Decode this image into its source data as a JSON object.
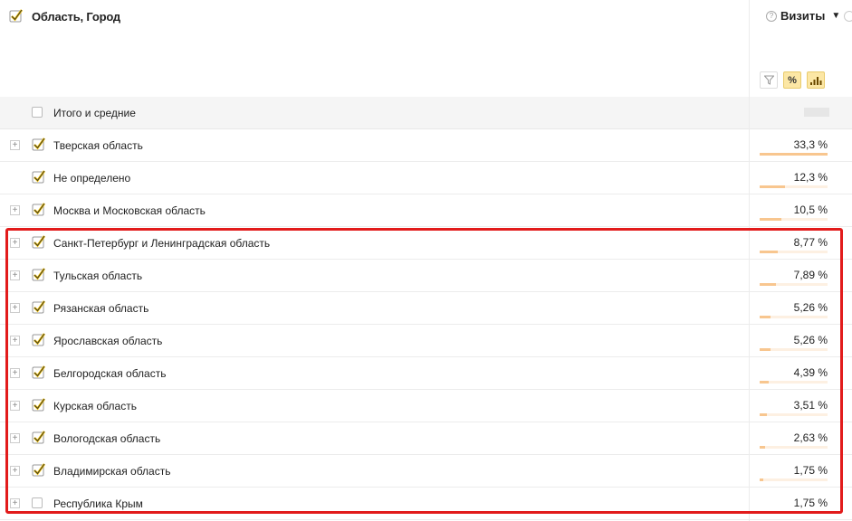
{
  "header": {
    "title": "Область, Город",
    "metric": "Визиты",
    "percent_symbol": "%"
  },
  "total_row": {
    "label": "Итого и средние"
  },
  "rows": [
    {
      "label": "Тверская область",
      "value": "33,3 %",
      "percent": 33.3,
      "checked": true,
      "expandable": true
    },
    {
      "label": "Не определено",
      "value": "12,3 %",
      "percent": 12.3,
      "checked": true,
      "expandable": false
    },
    {
      "label": "Москва и Московская область",
      "value": "10,5 %",
      "percent": 10.5,
      "checked": true,
      "expandable": true
    },
    {
      "label": "Санкт-Петербург и Ленинградская область",
      "value": "8,77 %",
      "percent": 8.77,
      "checked": true,
      "expandable": true
    },
    {
      "label": "Тульская область",
      "value": "7,89 %",
      "percent": 7.89,
      "checked": true,
      "expandable": true
    },
    {
      "label": "Рязанская область",
      "value": "5,26 %",
      "percent": 5.26,
      "checked": true,
      "expandable": true
    },
    {
      "label": "Ярославская область",
      "value": "5,26 %",
      "percent": 5.26,
      "checked": true,
      "expandable": true
    },
    {
      "label": "Белгородская область",
      "value": "4,39 %",
      "percent": 4.39,
      "checked": true,
      "expandable": true
    },
    {
      "label": "Курская область",
      "value": "3,51 %",
      "percent": 3.51,
      "checked": true,
      "expandable": true
    },
    {
      "label": "Вологодская область",
      "value": "2,63 %",
      "percent": 2.63,
      "checked": true,
      "expandable": true
    },
    {
      "label": "Владимирская область",
      "value": "1,75 %",
      "percent": 1.75,
      "checked": true,
      "expandable": true
    },
    {
      "label": "Республика Крым",
      "value": "1,75 %",
      "percent": 1.75,
      "checked": false,
      "expandable": true
    }
  ],
  "colors": {
    "accent": "#fce7a5",
    "check": "#f5c400",
    "bar": "#f8c68f",
    "highlight": "#e21b1b"
  },
  "icons": {
    "filter": "filter-icon",
    "percent": "percent-icon",
    "bars": "bar-chart-icon",
    "info": "help-icon"
  }
}
